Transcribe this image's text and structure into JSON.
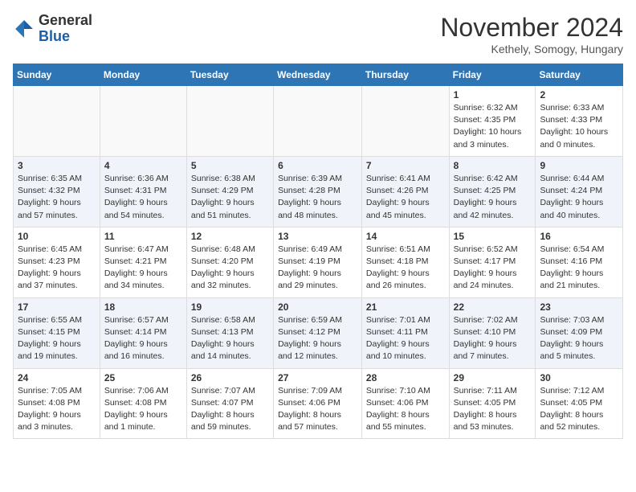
{
  "header": {
    "logo_general": "General",
    "logo_blue": "Blue",
    "month": "November 2024",
    "location": "Kethely, Somogy, Hungary"
  },
  "days_of_week": [
    "Sunday",
    "Monday",
    "Tuesday",
    "Wednesday",
    "Thursday",
    "Friday",
    "Saturday"
  ],
  "weeks": [
    [
      {
        "day": "",
        "info": ""
      },
      {
        "day": "",
        "info": ""
      },
      {
        "day": "",
        "info": ""
      },
      {
        "day": "",
        "info": ""
      },
      {
        "day": "",
        "info": ""
      },
      {
        "day": "1",
        "info": "Sunrise: 6:32 AM\nSunset: 4:35 PM\nDaylight: 10 hours\nand 3 minutes."
      },
      {
        "day": "2",
        "info": "Sunrise: 6:33 AM\nSunset: 4:33 PM\nDaylight: 10 hours\nand 0 minutes."
      }
    ],
    [
      {
        "day": "3",
        "info": "Sunrise: 6:35 AM\nSunset: 4:32 PM\nDaylight: 9 hours\nand 57 minutes."
      },
      {
        "day": "4",
        "info": "Sunrise: 6:36 AM\nSunset: 4:31 PM\nDaylight: 9 hours\nand 54 minutes."
      },
      {
        "day": "5",
        "info": "Sunrise: 6:38 AM\nSunset: 4:29 PM\nDaylight: 9 hours\nand 51 minutes."
      },
      {
        "day": "6",
        "info": "Sunrise: 6:39 AM\nSunset: 4:28 PM\nDaylight: 9 hours\nand 48 minutes."
      },
      {
        "day": "7",
        "info": "Sunrise: 6:41 AM\nSunset: 4:26 PM\nDaylight: 9 hours\nand 45 minutes."
      },
      {
        "day": "8",
        "info": "Sunrise: 6:42 AM\nSunset: 4:25 PM\nDaylight: 9 hours\nand 42 minutes."
      },
      {
        "day": "9",
        "info": "Sunrise: 6:44 AM\nSunset: 4:24 PM\nDaylight: 9 hours\nand 40 minutes."
      }
    ],
    [
      {
        "day": "10",
        "info": "Sunrise: 6:45 AM\nSunset: 4:23 PM\nDaylight: 9 hours\nand 37 minutes."
      },
      {
        "day": "11",
        "info": "Sunrise: 6:47 AM\nSunset: 4:21 PM\nDaylight: 9 hours\nand 34 minutes."
      },
      {
        "day": "12",
        "info": "Sunrise: 6:48 AM\nSunset: 4:20 PM\nDaylight: 9 hours\nand 32 minutes."
      },
      {
        "day": "13",
        "info": "Sunrise: 6:49 AM\nSunset: 4:19 PM\nDaylight: 9 hours\nand 29 minutes."
      },
      {
        "day": "14",
        "info": "Sunrise: 6:51 AM\nSunset: 4:18 PM\nDaylight: 9 hours\nand 26 minutes."
      },
      {
        "day": "15",
        "info": "Sunrise: 6:52 AM\nSunset: 4:17 PM\nDaylight: 9 hours\nand 24 minutes."
      },
      {
        "day": "16",
        "info": "Sunrise: 6:54 AM\nSunset: 4:16 PM\nDaylight: 9 hours\nand 21 minutes."
      }
    ],
    [
      {
        "day": "17",
        "info": "Sunrise: 6:55 AM\nSunset: 4:15 PM\nDaylight: 9 hours\nand 19 minutes."
      },
      {
        "day": "18",
        "info": "Sunrise: 6:57 AM\nSunset: 4:14 PM\nDaylight: 9 hours\nand 16 minutes."
      },
      {
        "day": "19",
        "info": "Sunrise: 6:58 AM\nSunset: 4:13 PM\nDaylight: 9 hours\nand 14 minutes."
      },
      {
        "day": "20",
        "info": "Sunrise: 6:59 AM\nSunset: 4:12 PM\nDaylight: 9 hours\nand 12 minutes."
      },
      {
        "day": "21",
        "info": "Sunrise: 7:01 AM\nSunset: 4:11 PM\nDaylight: 9 hours\nand 10 minutes."
      },
      {
        "day": "22",
        "info": "Sunrise: 7:02 AM\nSunset: 4:10 PM\nDaylight: 9 hours\nand 7 minutes."
      },
      {
        "day": "23",
        "info": "Sunrise: 7:03 AM\nSunset: 4:09 PM\nDaylight: 9 hours\nand 5 minutes."
      }
    ],
    [
      {
        "day": "24",
        "info": "Sunrise: 7:05 AM\nSunset: 4:08 PM\nDaylight: 9 hours\nand 3 minutes."
      },
      {
        "day": "25",
        "info": "Sunrise: 7:06 AM\nSunset: 4:08 PM\nDaylight: 9 hours\nand 1 minute."
      },
      {
        "day": "26",
        "info": "Sunrise: 7:07 AM\nSunset: 4:07 PM\nDaylight: 8 hours\nand 59 minutes."
      },
      {
        "day": "27",
        "info": "Sunrise: 7:09 AM\nSunset: 4:06 PM\nDaylight: 8 hours\nand 57 minutes."
      },
      {
        "day": "28",
        "info": "Sunrise: 7:10 AM\nSunset: 4:06 PM\nDaylight: 8 hours\nand 55 minutes."
      },
      {
        "day": "29",
        "info": "Sunrise: 7:11 AM\nSunset: 4:05 PM\nDaylight: 8 hours\nand 53 minutes."
      },
      {
        "day": "30",
        "info": "Sunrise: 7:12 AM\nSunset: 4:05 PM\nDaylight: 8 hours\nand 52 minutes."
      }
    ]
  ]
}
